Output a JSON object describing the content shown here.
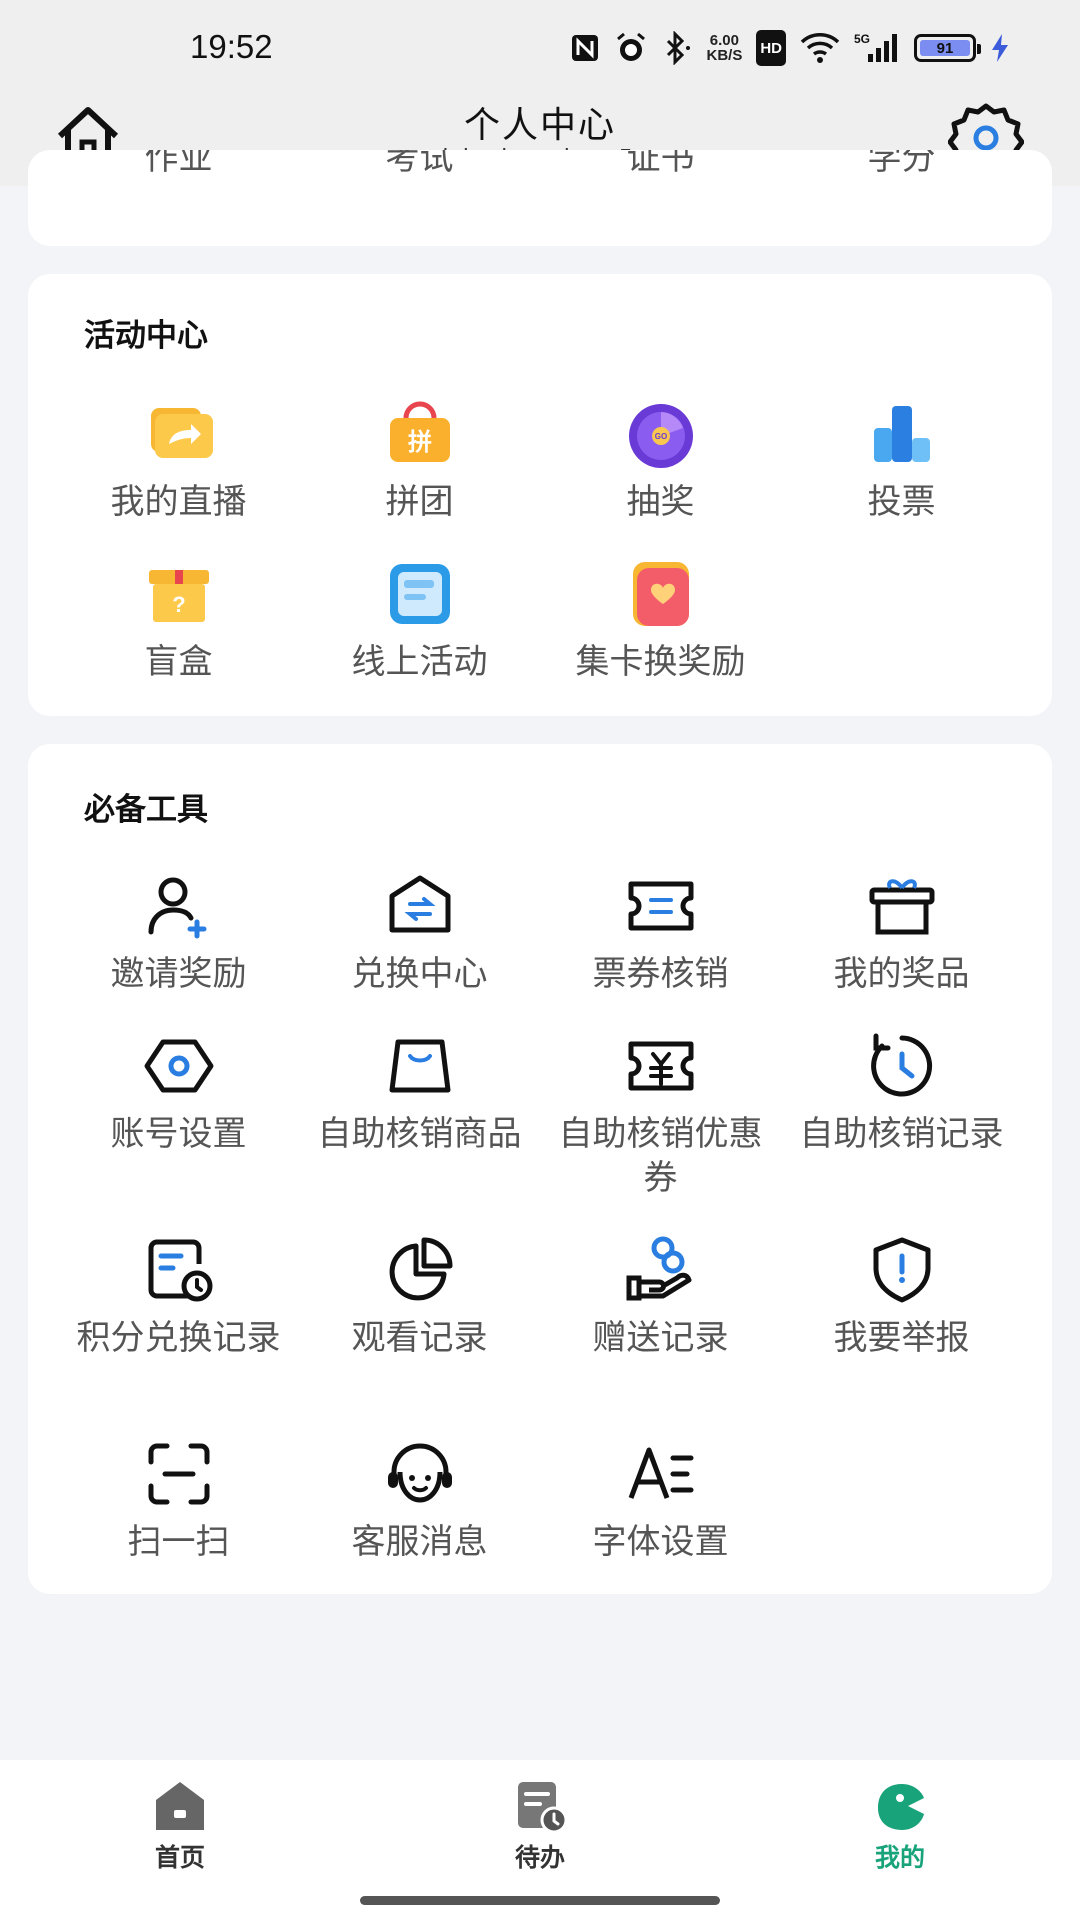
{
  "status_bar": {
    "time": "19:52",
    "net_speed_value": "6.00",
    "net_speed_unit": "KB/S",
    "hd": "HD",
    "network": "5G",
    "battery_level": "91",
    "icons": [
      "nfc-icon",
      "alarm-icon",
      "bluetooth-icon",
      "wifi-icon",
      "signal-icon",
      "charging-icon"
    ]
  },
  "header": {
    "title": "个人中心",
    "url": "aglrdw.zhongxinyan5.cn"
  },
  "top_card": {
    "items": [
      "作业",
      "考试",
      "证书",
      "学分"
    ]
  },
  "activity_center": {
    "title": "活动中心",
    "items": [
      {
        "label": "我的直播",
        "icon": "live-icon"
      },
      {
        "label": "拼团",
        "icon": "group-buy-icon"
      },
      {
        "label": "抽奖",
        "icon": "lottery-wheel-icon"
      },
      {
        "label": "投票",
        "icon": "vote-icon"
      },
      {
        "label": "盲盒",
        "icon": "blind-box-icon"
      },
      {
        "label": "线上活动",
        "icon": "online-activity-icon"
      },
      {
        "label": "集卡换奖励",
        "icon": "card-collect-icon"
      }
    ]
  },
  "tools": {
    "title": "必备工具",
    "items": [
      {
        "label": "邀请奖励",
        "icon": "invite-user-icon"
      },
      {
        "label": "兑换中心",
        "icon": "exchange-icon"
      },
      {
        "label": "票券核销",
        "icon": "ticket-icon"
      },
      {
        "label": "我的奖品",
        "icon": "gift-box-icon"
      },
      {
        "label": "账号设置",
        "icon": "account-settings-icon"
      },
      {
        "label": "自助核销商品",
        "icon": "shopping-bag-icon"
      },
      {
        "label": "自助核销优惠券",
        "icon": "coupon-icon"
      },
      {
        "label": "自助核销记录",
        "icon": "history-icon"
      },
      {
        "label": "积分兑换记录",
        "icon": "points-record-icon"
      },
      {
        "label": "观看记录",
        "icon": "pie-chart-icon"
      },
      {
        "label": "赠送记录",
        "icon": "give-icon"
      },
      {
        "label": "我要举报",
        "icon": "report-shield-icon"
      },
      {
        "label": "扫一扫",
        "icon": "scan-icon"
      },
      {
        "label": "客服消息",
        "icon": "customer-service-icon"
      },
      {
        "label": "字体设置",
        "icon": "font-settings-icon"
      }
    ]
  },
  "bottom_nav": {
    "items": [
      {
        "label": "首页",
        "icon": "home-nav-icon"
      },
      {
        "label": "待办",
        "icon": "todo-nav-icon"
      },
      {
        "label": "我的",
        "icon": "mine-nav-icon"
      }
    ],
    "active_index": 2
  },
  "colors": {
    "accent": "#19a37a",
    "icon_blue": "#2a7de1",
    "text_gray": "#555555"
  }
}
